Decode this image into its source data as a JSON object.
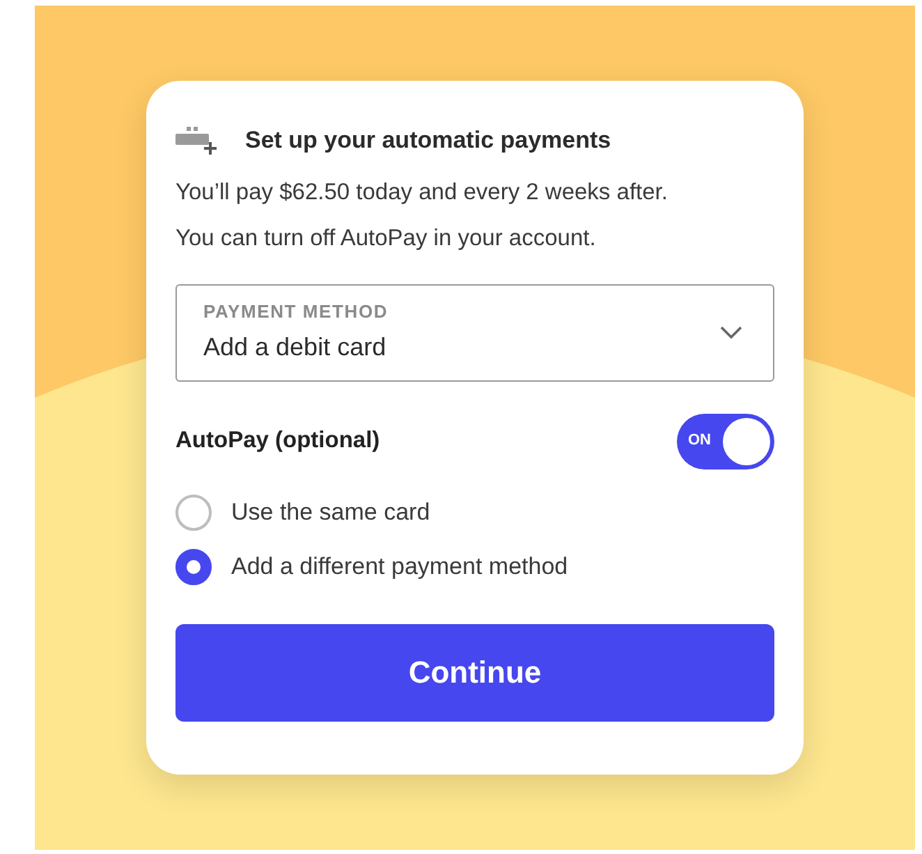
{
  "card": {
    "title": "Set up your automatic payments",
    "description": [
      "You’ll pay $62.50 today and every 2 weeks after.",
      "You can turn off AutoPay in your account."
    ],
    "payment_method": {
      "label": "PAYMENT METHOD",
      "value": "Add a debit card"
    },
    "autopay": {
      "label": "AutoPay (optional)",
      "on": true,
      "state_text": "ON"
    },
    "options": [
      {
        "label": "Use the same card",
        "selected": false
      },
      {
        "label": "Add a different payment method",
        "selected": true
      }
    ],
    "button": "Continue"
  }
}
